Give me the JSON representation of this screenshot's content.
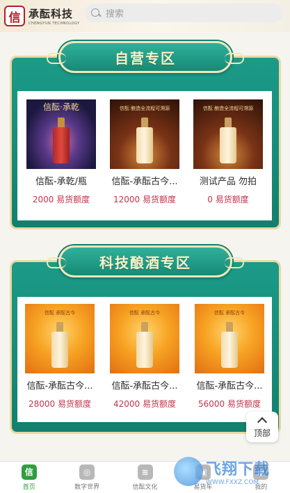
{
  "header": {
    "logo_char": "信",
    "brand_name": "承酝科技",
    "brand_en": "CHENGYUN TECHNOLOGY",
    "search_placeholder": "搜索"
  },
  "sections": [
    {
      "title": "自营专区",
      "products": [
        {
          "name": "信酝-承乾/瓶",
          "price": "2000 易货额度",
          "image_text": "信酝·承乾",
          "image_style": "space"
        },
        {
          "name": "信酝-承酝古今...",
          "price": "12000 易货额度",
          "image_text": "信酝 酿造全流程可溯源",
          "image_style": "dark"
        },
        {
          "name": "测试产品 勿拍",
          "price": "0 易货额度",
          "image_text": "信酝 酿造全流程可溯源",
          "image_style": "dark"
        }
      ]
    },
    {
      "title": "科技酿酒专区",
      "products": [
        {
          "name": "信酝-承酝古今...",
          "price": "28000 易货额度",
          "image_text": "信酝 承酝古今",
          "image_style": "gold"
        },
        {
          "name": "信酝-承酝古今...",
          "price": "42000 易货额度",
          "image_text": "信酝 承酝古今",
          "image_style": "gold"
        },
        {
          "name": "信酝-承酝古今...",
          "price": "56000 易货额度",
          "image_text": "信酝 承酝古今",
          "image_style": "gold"
        }
      ]
    }
  ],
  "back_to_top": "顶部",
  "tabbar": [
    {
      "label": "首页",
      "icon": "home-icon",
      "active": true
    },
    {
      "label": "数字世界",
      "icon": "gamepad-icon",
      "active": false
    },
    {
      "label": "信酝文化",
      "icon": "layers-icon",
      "active": false
    },
    {
      "label": "易货车",
      "icon": "cart-icon",
      "active": false
    },
    {
      "label": "我的",
      "icon": "user-icon",
      "active": false
    }
  ],
  "watermark": {
    "text": "飞翔下载",
    "url_text": "WWW.FXXZ.COM"
  },
  "colors": {
    "teal": "#168a77",
    "gold_border": "#e7d9a6",
    "price": "#c3334b",
    "active_tab": "#2f9e3f"
  }
}
